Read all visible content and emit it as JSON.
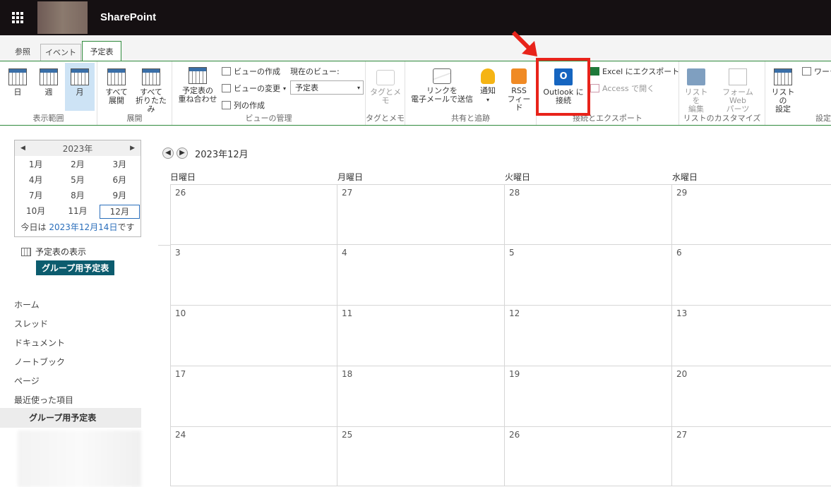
{
  "brand": "SharePoint",
  "tabs": {
    "browse": "参照",
    "event": "イベント",
    "calendar": "予定表"
  },
  "ribbon": {
    "scope": {
      "day": "日",
      "week": "週",
      "month": "月",
      "label": "表示範囲"
    },
    "expand": {
      "expand_all": [
        "すべて",
        "展開"
      ],
      "collapse_all": [
        "すべて",
        "折りたたみ"
      ],
      "label": "展開"
    },
    "view": {
      "overlay": [
        "予定表の",
        "重ね合わせ"
      ],
      "create_view": "ビューの作成",
      "modify_view": "ビューの変更",
      "create_column": "列の作成",
      "current_view_label": "現在のビュー:",
      "current_view_value": "予定表",
      "label": "ビューの管理"
    },
    "tags": {
      "button": "タグとメモ",
      "label": "タグとメモ"
    },
    "share": {
      "email_link": [
        "リンクを",
        "電子メールで送信"
      ],
      "alert": "通知",
      "rss": [
        "RSS",
        "フィード"
      ],
      "label": "共有と追跡"
    },
    "connect": {
      "outlook": [
        "Outlook に",
        "接続"
      ],
      "excel": "Excel にエクスポート",
      "access": "Access で開く",
      "label": "接続とエクスポート"
    },
    "customize": {
      "edit_list": [
        "リストを",
        "編集"
      ],
      "form_web_parts": [
        "フォーム Web",
        "パーツ"
      ],
      "label": "リストのカスタマイズ"
    },
    "settings": {
      "list_settings": [
        "リストの",
        "設定"
      ],
      "workflow": "ワーク",
      "label": "設定"
    }
  },
  "datepicker": {
    "year": "2023年",
    "months": [
      "1月",
      "2月",
      "3月",
      "4月",
      "5月",
      "6月",
      "7月",
      "8月",
      "9月",
      "10月",
      "11月",
      "12月"
    ],
    "selected_index": 11,
    "today_prefix": "今日は ",
    "today_link": "2023年12月14日",
    "today_suffix": "です"
  },
  "calendar_show": "予定表の表示",
  "group_calendar": "グループ用予定表",
  "nav": [
    "ホーム",
    "スレッド",
    "ドキュメント",
    "ノートブック",
    "ページ",
    "最近使った項目"
  ],
  "nav_current": "グループ用予定表",
  "month_title": "2023年12月",
  "day_headers": [
    "日曜日",
    "月曜日",
    "火曜日",
    "水曜日"
  ],
  "weeks": [
    [
      "26",
      "27",
      "28",
      "29"
    ],
    [
      "3",
      "4",
      "5",
      "6"
    ],
    [
      "10",
      "11",
      "12",
      "13"
    ],
    [
      "17",
      "18",
      "19",
      "20"
    ],
    [
      "24",
      "25",
      "26",
      "27"
    ]
  ],
  "colors": {
    "accent_green": "#2f8a3c",
    "highlight_red": "#e8231a",
    "link_blue": "#2a6ebb",
    "badge_teal": "#0c5c6e"
  }
}
